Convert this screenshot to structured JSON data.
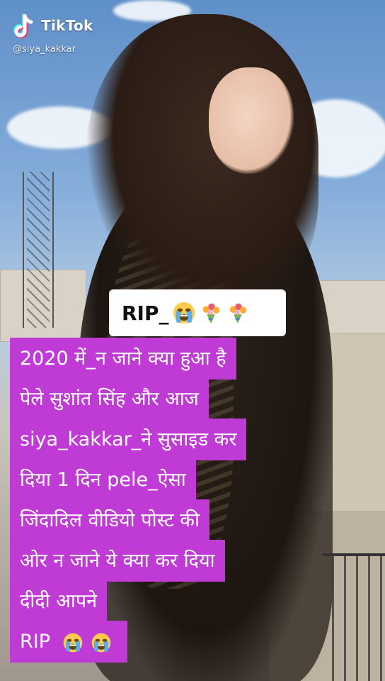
{
  "app": {
    "brand": "TikTok",
    "handle": "@siya_kakkar"
  },
  "overlay": {
    "rip_label": "RIP_",
    "rip_emojis": [
      "crying-face",
      "bouquet",
      "bouquet"
    ]
  },
  "caption": {
    "lines": [
      "2020 में_न जाने क्या हुआ है",
      "पेले सुशांत सिंह और आज",
      "siya_kakkar_ने सुसाइड कर",
      "दिया 1 दिन pele_ऐसा",
      "जिंदादिल वीडियो पोस्ट की",
      "ओर न जाने ये क्या कर दिया",
      "दीदी आपने",
      "RIP"
    ],
    "last_line_emojis": [
      "crying-face",
      "crying-face"
    ]
  },
  "colors": {
    "caption_bg": "#c03bd6",
    "caption_text": "#ffffff",
    "rip_box_bg": "#ffffff",
    "tiktok_cyan": "#25f4ee",
    "tiktok_red": "#fe2c55"
  }
}
